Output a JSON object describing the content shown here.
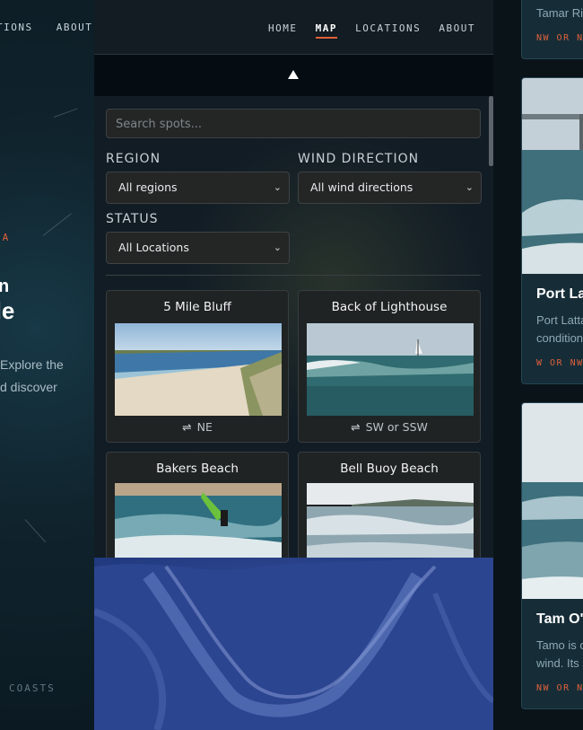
{
  "left_panel": {
    "nav_partial": [
      "TIONS",
      "ABOUT"
    ],
    "eyebrow": "IA",
    "heading_lines": [
      "n",
      "de"
    ],
    "description_lines": [
      "Explore the",
      "d discover"
    ],
    "footer_text": "COASTS"
  },
  "header": {
    "nav": [
      {
        "label": "HOME",
        "active": false
      },
      {
        "label": "MAP",
        "active": true
      },
      {
        "label": "LOCATIONS",
        "active": false
      },
      {
        "label": "ABOUT",
        "active": false
      }
    ],
    "toggle_icon": "triangle-up-icon"
  },
  "filters": {
    "search_placeholder": "Search spots...",
    "region_label": "REGION",
    "region_value": "All regions",
    "wind_label": "WIND DIRECTION",
    "wind_value": "All wind directions",
    "status_label": "STATUS",
    "status_value": "All Locations"
  },
  "spots": [
    {
      "name": "5 Mile Bluff",
      "wind": "NE"
    },
    {
      "name": "Back of Lighthouse",
      "wind": "SW or SSW"
    },
    {
      "name": "Bakers Beach",
      "wind": ""
    },
    {
      "name": "Bell Buoy Beach",
      "wind": ""
    }
  ],
  "right_panel": {
    "top_card": {
      "desc": "Tamar Riv",
      "tag": "NW OR NE"
    },
    "cards": [
      {
        "title": "Port La",
        "desc_lines": [
          "Port Latta",
          "condition"
        ],
        "tag": "W OR NW"
      },
      {
        "title": "Tam O'",
        "desc_lines": [
          "Tamo is o",
          "wind. Its s"
        ],
        "tag": "NW OR NN"
      }
    ]
  },
  "colors": {
    "accent": "#e0603a",
    "card_bg": "#1f2324",
    "panel_bg": "#111c24"
  }
}
